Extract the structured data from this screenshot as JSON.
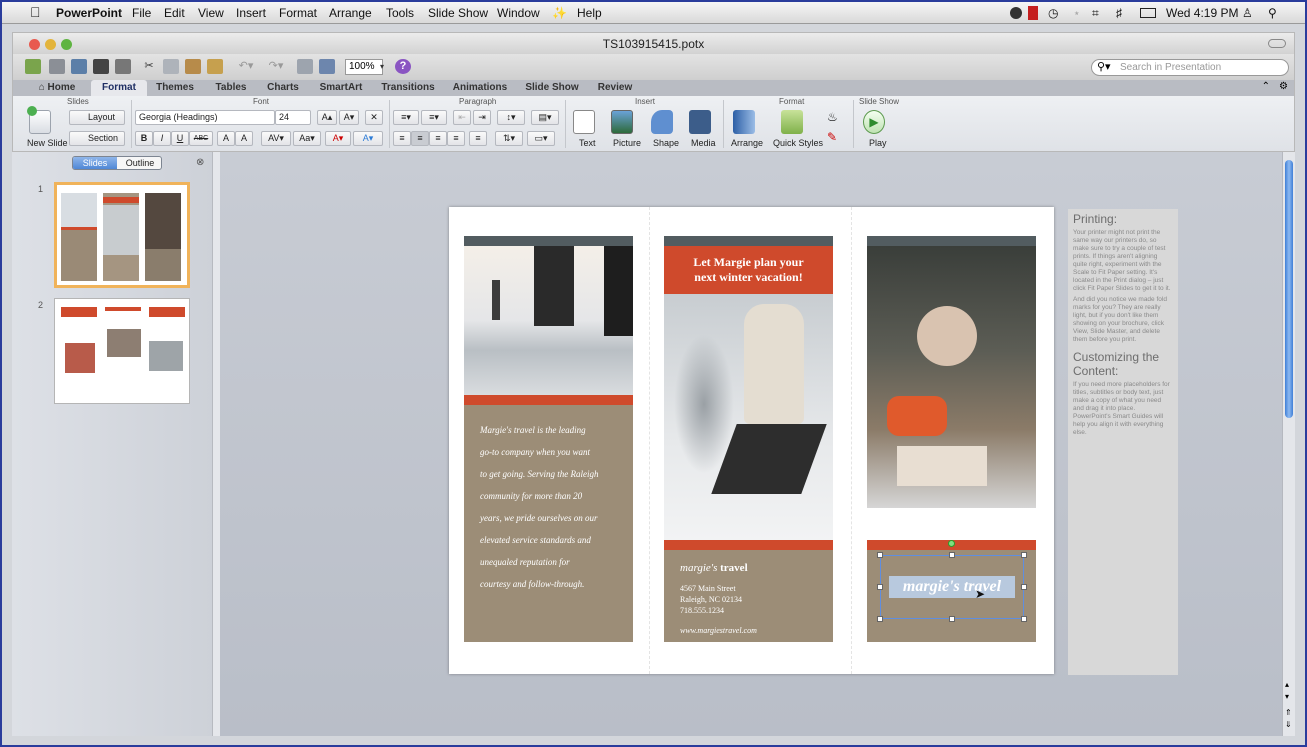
{
  "menubar": {
    "app": "PowerPoint",
    "items": [
      "File",
      "Edit",
      "View",
      "Insert",
      "Format",
      "Arrange",
      "Tools",
      "Slide Show",
      "Window",
      "Help"
    ],
    "clock": "Wed 4:19 PM"
  },
  "window": {
    "title": "TS103915415.potx"
  },
  "toolbar": {
    "zoom": "100%",
    "search_placeholder": "Search in Presentation"
  },
  "ribbon": {
    "tabs": [
      "Home",
      "Format",
      "Themes",
      "Tables",
      "Charts",
      "SmartArt",
      "Transitions",
      "Animations",
      "Slide Show",
      "Review"
    ],
    "active_tab": "Format",
    "groups": {
      "slides": "Slides",
      "font": "Font",
      "paragraph": "Paragraph",
      "insert": "Insert",
      "format": "Format",
      "slideshow": "Slide Show"
    },
    "new_slide": "New Slide",
    "layout": "Layout",
    "section": "Section",
    "font_name": "Georgia (Headings)",
    "font_size": "24",
    "text": "Text",
    "picture": "Picture",
    "shape": "Shape",
    "media": "Media",
    "arrange": "Arrange",
    "quick_styles": "Quick Styles",
    "play": "Play",
    "bold": "B",
    "italic": "I",
    "underline": "U",
    "strike": "ABC",
    "superscript": "A",
    "subscript": "A"
  },
  "sidebar": {
    "seg_slides": "Slides",
    "seg_outline": "Outline",
    "slide_numbers": [
      "1",
      "2"
    ]
  },
  "slide": {
    "panel1_text": [
      "Margie's travel is the leading",
      "go-to company when you want",
      "to get going. Serving the Raleigh",
      "community for more than 20",
      "years, we pride ourselves on our",
      "elevated service standards and",
      "unequaled reputation for",
      "courtesy and follow-through."
    ],
    "panel2_headline1": "Let Margie plan your",
    "panel2_headline2": "next winter vacation!",
    "brand_italic": "margie's",
    "brand_bold": "travel",
    "address1": "4567 Main Street",
    "address2": "Raleigh, NC 02134",
    "phone": "718.555.1234",
    "url": "www.margiestravel.com",
    "selected_title": "margie's travel"
  },
  "notes": {
    "h1": "Printing:",
    "p1": "Your printer might not print the same way our printers do, so make sure to try a couple of test prints. If things aren't aligning quite right, experiment with the Scale to Fit Paper setting. It's located in the Print dialog – just click Fit Paper Slides to get it to it.",
    "p2": "And did you notice we made fold marks for you? They are really light, but if you don't like them showing on your brochure, click View, Slide Master, and delete them before you print.",
    "h2": "Customizing the Content:",
    "p3": "If you need more placeholders for titles, subtitles or body text, just make a copy of what you need and drag it into place. PowerPoint's Smart Guides will help you align it with everything else."
  }
}
